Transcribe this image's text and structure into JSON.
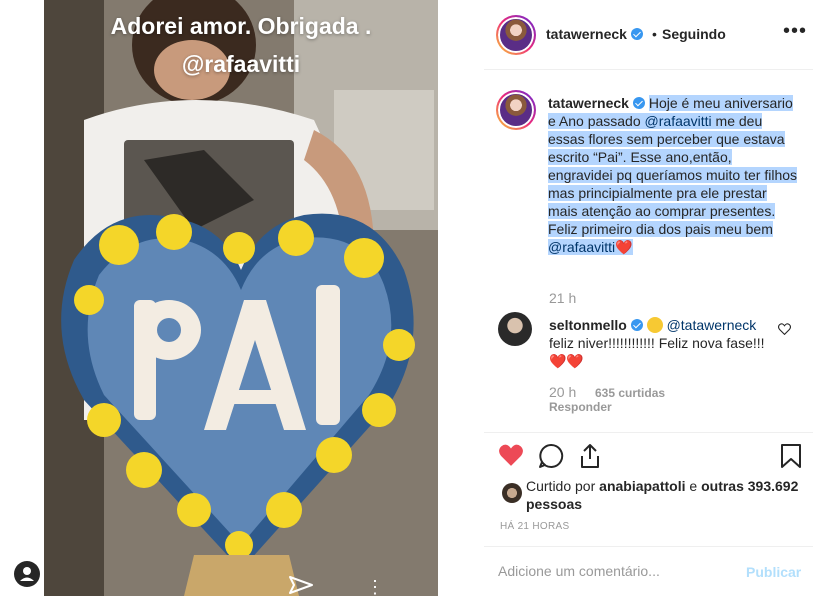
{
  "story": {
    "caption_line1": "Adorei amor. Obrigada .",
    "caption_line2": "@rafaavitti"
  },
  "header": {
    "username": "tatawerneck",
    "separator": "•",
    "follow_status": "Seguindo",
    "more": "•••"
  },
  "caption": {
    "username": "tatawerneck",
    "text_before": "Hoje é meu aniversario e Ano passado ",
    "mention1": "@rafaavitti",
    "text_middle": " me deu essas flores sem perceber que estava escrito “Pai”. Esse ano,então, engravidei pq queríamos muito ter filhos mas principialmente pra ele prestar mais atenção ao comprar presentes. Feliz primeiro dia dos pais meu bem ",
    "mention2": "@rafaavitti",
    "heart": "❤️",
    "time": "21 h"
  },
  "comment": {
    "username": "seltonmello",
    "mention": "@tatawerneck",
    "text": "feliz niver!!!!!!!!!!!! Feliz nova fase!!!",
    "hearts": "❤️❤️",
    "time": "20 h",
    "likes": "635 curtidas",
    "reply": "Responder"
  },
  "likes": {
    "prefix": "Curtido por ",
    "user": "anabiapattoli",
    "middle": " e ",
    "others": "outras 393.692 pessoas"
  },
  "timestamp": "HÁ 21 HORAS",
  "add_comment": {
    "placeholder": "Adicione um comentário...",
    "publish": "Publicar"
  },
  "colors": {
    "heart_red": "#ed4956",
    "link_blue": "#003569",
    "verified_blue": "#3897f0",
    "selection": "#b4d5fe",
    "publish_disabled": "#b2dffc"
  }
}
